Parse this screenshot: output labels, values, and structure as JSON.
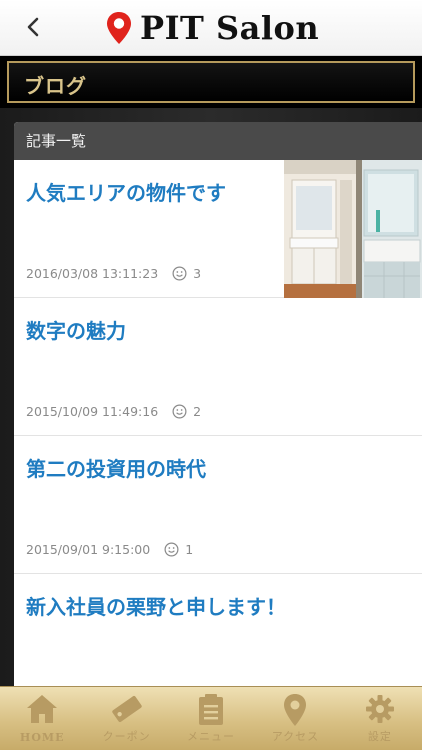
{
  "app": {
    "logo_text": "PIT Salon"
  },
  "section": {
    "title": "ブログ"
  },
  "panel": {
    "header": "記事一覧"
  },
  "articles": [
    {
      "title": "人気エリアの物件です",
      "date": "2016/03/08 13:11:23",
      "likes": "3",
      "has_thumbnail": true
    },
    {
      "title": "数字の魅力",
      "date": "2015/10/09 11:49:16",
      "likes": "2",
      "has_thumbnail": false
    },
    {
      "title": "第二の投資用の時代",
      "date": "2015/09/01 9:15:00",
      "likes": "1",
      "has_thumbnail": false
    },
    {
      "title": "新入社員の栗野と申します！",
      "date": "",
      "likes": "",
      "has_thumbnail": false
    }
  ],
  "tabs": [
    {
      "label": "HOME",
      "icon": "home-icon"
    },
    {
      "label": "クーポン",
      "icon": "coupon-icon"
    },
    {
      "label": "メニュー",
      "icon": "menu-icon"
    },
    {
      "label": "アクセス",
      "icon": "map-pin-icon"
    },
    {
      "label": "設定",
      "icon": "gear-icon"
    }
  ],
  "colors": {
    "accent_blue": "#1f7cc1",
    "gold": "#b59a5c",
    "logo_red": "#e0231c",
    "tabbar_gold": "#d8c084"
  }
}
